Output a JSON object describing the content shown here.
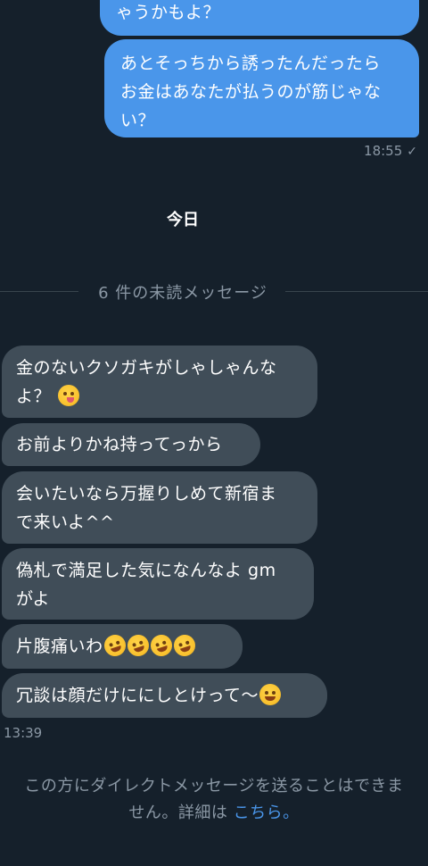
{
  "outgoing": {
    "partial_text": "ゃうかもよ？",
    "message_line1": "あとそっちから誘ったんだったら",
    "message_line2": "お金はあなたが払うのが筋じゃな",
    "message_line3": "い？",
    "timestamp": "18:55",
    "read_mark": "✓"
  },
  "day_divider": "今日",
  "unread_divider": "6 件の未読メッセージ",
  "incoming": [
    {
      "line1": "金のないクソガキがしゃしゃんな",
      "line2": "よ？",
      "emoji": "yum-face-icon"
    },
    {
      "line1": "お前よりかね持ってっから"
    },
    {
      "line1": "会いたいなら万握りしめて新宿ま",
      "line2": "で来いよ^^"
    },
    {
      "line1": "偽札で満足した気になんなよ gm",
      "line2": "がよ"
    },
    {
      "line1": "片腹痛いわ",
      "emoji": "rofl-icon",
      "emoji_count": 4
    },
    {
      "line1": "冗談は顔だけににしとけって〜",
      "emoji": "tears-of-joy-icon"
    }
  ],
  "incoming_timestamp": "13:39",
  "footer": {
    "line1": "この方にダイレクトメッセージを送ることはできま",
    "line2_prefix": "せん。詳細は",
    "link": "こちら",
    "line2_suffix": "。"
  },
  "colors": {
    "background": "#15202b",
    "outgoing_bubble": "#4a96ea",
    "incoming_bubble": "#404d58",
    "muted_text": "#8b98a5",
    "link": "#4a96ea"
  }
}
